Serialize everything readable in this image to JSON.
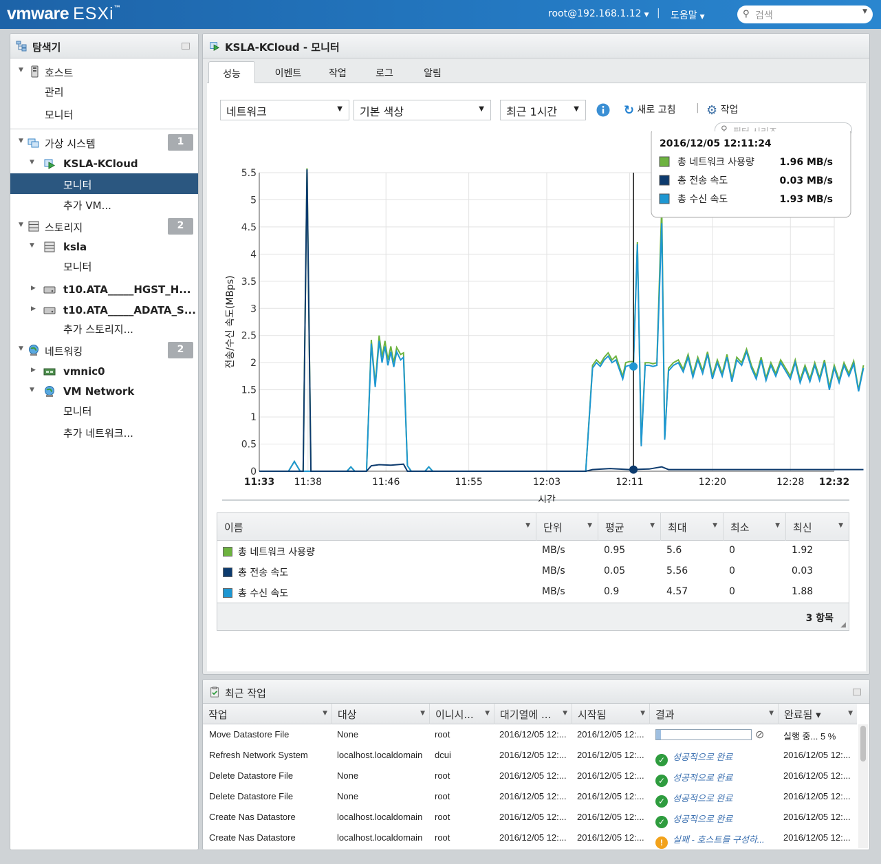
{
  "topbar": {
    "brand": "vmware",
    "product": "ESXi",
    "tm": "™",
    "user": "root@192.168.1.12",
    "separator": "|",
    "help": "도움말",
    "search_placeholder": "검색"
  },
  "navigator": {
    "title": "탐색기",
    "host": "호스트",
    "host_manage": "관리",
    "host_monitor": "모니터",
    "vms": "가상 시스템",
    "vms_count": "1",
    "vm_name": "KSLA-KCloud",
    "vm_monitor": "모니터",
    "vm_more": "추가 VM...",
    "storage": "스토리지",
    "storage_count": "2",
    "ds_name": "ksla",
    "ds_monitor": "모니터",
    "disk1": "t10.ATA_____HGST_H...",
    "disk2": "t10.ATA_____ADATA_S...",
    "storage_more": "추가 스토리지...",
    "networking": "네트워킹",
    "networking_count": "2",
    "nic": "vmnic0",
    "vmnet": "VM Network",
    "vmnet_monitor": "모니터",
    "net_more": "추가 네트워크..."
  },
  "main": {
    "title": "KSLA-KCloud - 모니터",
    "tabs": [
      "성능",
      "이벤트",
      "작업",
      "로그",
      "알림"
    ],
    "metric_select": "네트워크",
    "color_select": "기본 색상",
    "range_select": "최근 1시간",
    "refresh": "새로 고침",
    "actions": "작업",
    "filter_placeholder": "필터 시리즈"
  },
  "colors": {
    "usage": "#6db33f",
    "tx": "#0d3b6e",
    "rx": "#1e97d2"
  },
  "chart_data": {
    "type": "line",
    "ylabel": "전송/수신 속도(MBps)",
    "xlabel": "시간",
    "ylim": [
      0,
      5.5
    ],
    "yticks": [
      "0",
      "0.5",
      "1",
      "1.5",
      "2",
      "2.5",
      "3",
      "3.5",
      "4",
      "4.5",
      "5",
      "5.5"
    ],
    "xticks": [
      "11:33",
      "11:38",
      "11:46",
      "11:55",
      "12:03",
      "12:11",
      "12:20",
      "12:28",
      "12:32"
    ],
    "x_unit": "minutes after 11:33",
    "series": [
      {
        "name": "총 네트워크 사용량",
        "color": "#6db33f",
        "points": [
          [
            0,
            0
          ],
          [
            3,
            0
          ],
          [
            3.6,
            0.18
          ],
          [
            4.2,
            0
          ],
          [
            4.5,
            0
          ],
          [
            4.9,
            5.58
          ],
          [
            5.3,
            0
          ],
          [
            9,
            0
          ],
          [
            9.4,
            0.08
          ],
          [
            9.8,
            0
          ],
          [
            11,
            0
          ],
          [
            11.5,
            2.42
          ],
          [
            11.9,
            1.6
          ],
          [
            12.3,
            2.5
          ],
          [
            12.6,
            2.1
          ],
          [
            12.9,
            2.4
          ],
          [
            13.2,
            2.05
          ],
          [
            13.5,
            2.3
          ],
          [
            13.8,
            2.0
          ],
          [
            14.1,
            2.28
          ],
          [
            14.5,
            2.15
          ],
          [
            14.8,
            2.18
          ],
          [
            15.2,
            0.1
          ],
          [
            15.6,
            0
          ],
          [
            17,
            0
          ],
          [
            17.4,
            0.08
          ],
          [
            17.8,
            0
          ],
          [
            33.5,
            0
          ],
          [
            34.2,
            1.95
          ],
          [
            34.6,
            2.05
          ],
          [
            35,
            1.98
          ],
          [
            35.4,
            2.1
          ],
          [
            35.8,
            2.18
          ],
          [
            36.2,
            2.05
          ],
          [
            36.6,
            2.12
          ],
          [
            37,
            1.9
          ],
          [
            37.3,
            1.75
          ],
          [
            37.6,
            2.0
          ],
          [
            38,
            2.02
          ],
          [
            38.4,
            2.02
          ],
          [
            38.8,
            4.22
          ],
          [
            39.2,
            0.5
          ],
          [
            39.6,
            2.0
          ],
          [
            40,
            2.0
          ],
          [
            40.4,
            1.98
          ],
          [
            40.8,
            2.0
          ],
          [
            41.3,
            4.9
          ],
          [
            41.6,
            0.6
          ],
          [
            42,
            1.9
          ],
          [
            42.5,
            2.0
          ],
          [
            43,
            2.05
          ],
          [
            43.5,
            1.88
          ],
          [
            44,
            2.15
          ],
          [
            44.5,
            1.78
          ],
          [
            45,
            2.1
          ],
          [
            45.5,
            1.85
          ],
          [
            46,
            2.2
          ],
          [
            46.5,
            1.75
          ],
          [
            47,
            2.05
          ],
          [
            47.5,
            1.8
          ],
          [
            48,
            2.15
          ],
          [
            48.5,
            1.7
          ],
          [
            49,
            2.1
          ],
          [
            49.5,
            2.0
          ],
          [
            50,
            2.25
          ],
          [
            50.5,
            1.95
          ],
          [
            51,
            1.75
          ],
          [
            51.5,
            2.1
          ],
          [
            52,
            1.72
          ],
          [
            52.5,
            2.0
          ],
          [
            53,
            1.8
          ],
          [
            53.5,
            2.05
          ],
          [
            54,
            1.9
          ],
          [
            54.5,
            1.75
          ],
          [
            55,
            2.05
          ],
          [
            55.5,
            1.68
          ],
          [
            56,
            1.95
          ],
          [
            56.5,
            1.7
          ],
          [
            57,
            2.0
          ],
          [
            57.5,
            1.72
          ],
          [
            58,
            2.05
          ],
          [
            58.5,
            1.55
          ],
          [
            59,
            1.95
          ],
          [
            59.5,
            1.68
          ],
          [
            60,
            2.0
          ],
          [
            60.5,
            1.8
          ],
          [
            61,
            2.03
          ],
          [
            61.5,
            1.5
          ],
          [
            62,
            1.95
          ]
        ]
      },
      {
        "name": "총 전송 속도",
        "color": "#0d3b6e",
        "points": [
          [
            0,
            0
          ],
          [
            4.5,
            0
          ],
          [
            4.9,
            5.56
          ],
          [
            5.3,
            0
          ],
          [
            11,
            0
          ],
          [
            11.5,
            0.1
          ],
          [
            12.3,
            0.12
          ],
          [
            13.5,
            0.11
          ],
          [
            14.8,
            0.13
          ],
          [
            15.2,
            0
          ],
          [
            33.5,
            0
          ],
          [
            34.2,
            0.03
          ],
          [
            36,
            0.05
          ],
          [
            38,
            0.03
          ],
          [
            40,
            0.04
          ],
          [
            41.3,
            0.08
          ],
          [
            42,
            0.03
          ],
          [
            50,
            0.03
          ],
          [
            62,
            0.03
          ]
        ]
      },
      {
        "name": "총 수신 속도",
        "color": "#1e97d2",
        "points": [
          [
            0,
            0
          ],
          [
            3,
            0
          ],
          [
            3.6,
            0.18
          ],
          [
            4.2,
            0
          ],
          [
            9,
            0
          ],
          [
            9.4,
            0.08
          ],
          [
            9.8,
            0
          ],
          [
            11,
            0
          ],
          [
            11.5,
            2.35
          ],
          [
            11.9,
            1.55
          ],
          [
            12.3,
            2.4
          ],
          [
            12.6,
            2.0
          ],
          [
            12.9,
            2.3
          ],
          [
            13.2,
            1.95
          ],
          [
            13.5,
            2.2
          ],
          [
            13.8,
            1.92
          ],
          [
            14.1,
            2.2
          ],
          [
            14.5,
            2.05
          ],
          [
            14.8,
            2.1
          ],
          [
            15.2,
            0.1
          ],
          [
            15.6,
            0
          ],
          [
            17,
            0
          ],
          [
            17.4,
            0.08
          ],
          [
            17.8,
            0
          ],
          [
            33.5,
            0
          ],
          [
            34.2,
            1.9
          ],
          [
            34.6,
            2.0
          ],
          [
            35,
            1.93
          ],
          [
            35.4,
            2.05
          ],
          [
            35.8,
            2.12
          ],
          [
            36.2,
            2.0
          ],
          [
            36.6,
            2.05
          ],
          [
            37,
            1.85
          ],
          [
            37.3,
            1.7
          ],
          [
            37.6,
            1.93
          ],
          [
            38,
            1.95
          ],
          [
            38.4,
            1.98
          ],
          [
            38.8,
            4.18
          ],
          [
            39.2,
            0.46
          ],
          [
            39.6,
            1.95
          ],
          [
            40,
            1.95
          ],
          [
            40.4,
            1.93
          ],
          [
            40.8,
            1.95
          ],
          [
            41.3,
            4.57
          ],
          [
            41.6,
            0.58
          ],
          [
            42,
            1.85
          ],
          [
            42.5,
            1.95
          ],
          [
            43,
            2.0
          ],
          [
            43.5,
            1.83
          ],
          [
            44,
            2.1
          ],
          [
            44.5,
            1.73
          ],
          [
            45,
            2.05
          ],
          [
            45.5,
            1.8
          ],
          [
            46,
            2.15
          ],
          [
            46.5,
            1.7
          ],
          [
            47,
            2.0
          ],
          [
            47.5,
            1.75
          ],
          [
            48,
            2.1
          ],
          [
            48.5,
            1.65
          ],
          [
            49,
            2.05
          ],
          [
            49.5,
            1.95
          ],
          [
            50,
            2.2
          ],
          [
            50.5,
            1.9
          ],
          [
            51,
            1.7
          ],
          [
            51.5,
            2.05
          ],
          [
            52,
            1.67
          ],
          [
            52.5,
            1.95
          ],
          [
            53,
            1.75
          ],
          [
            53.5,
            2.0
          ],
          [
            54,
            1.85
          ],
          [
            54.5,
            1.7
          ],
          [
            55,
            2.0
          ],
          [
            55.5,
            1.63
          ],
          [
            56,
            1.9
          ],
          [
            56.5,
            1.65
          ],
          [
            57,
            1.95
          ],
          [
            57.5,
            1.67
          ],
          [
            58,
            2.0
          ],
          [
            58.5,
            1.5
          ],
          [
            59,
            1.9
          ],
          [
            59.5,
            1.63
          ],
          [
            60,
            1.95
          ],
          [
            60.5,
            1.75
          ],
          [
            61,
            1.98
          ],
          [
            61.5,
            1.47
          ],
          [
            62,
            1.9
          ]
        ]
      }
    ],
    "cursor_x": 38.4,
    "tooltip": {
      "time": "2016/12/05 12:11:24",
      "rows": [
        {
          "name": "총 네트워크 사용량",
          "value": "1.96 MB/s"
        },
        {
          "name": "총 전송 속도",
          "value": "0.03 MB/s"
        },
        {
          "name": "총 수신 속도",
          "value": "1.93 MB/s"
        }
      ]
    }
  },
  "legend_table": {
    "headers": [
      "이름",
      "단위",
      "평균",
      "최대",
      "최소",
      "최신"
    ],
    "rows": [
      [
        "총 네트워크 사용량",
        "MB/s",
        "0.95",
        "5.6",
        "0",
        "1.92"
      ],
      [
        "총 전송 속도",
        "MB/s",
        "0.05",
        "5.56",
        "0",
        "0.03"
      ],
      [
        "총 수신 속도",
        "MB/s",
        "0.9",
        "4.57",
        "0",
        "1.88"
      ]
    ],
    "footer": "3 항목"
  },
  "recent_tasks": {
    "title": "최근 작업",
    "headers": [
      "작업",
      "대상",
      "이니시...",
      "대기열에 ...",
      "시작됨",
      "결과",
      "완료됨 ▾"
    ],
    "rows": [
      {
        "task": "Move Datastore File",
        "target": "None",
        "initiator": "root",
        "queued": "2016/12/05 12:...",
        "started": "2016/12/05 12:...",
        "result": "",
        "done": "실행 중... 5 %",
        "status": "running",
        "progress": 0.05
      },
      {
        "task": "Refresh Network System",
        "target": "localhost.localdomain",
        "initiator": "dcui",
        "queued": "2016/12/05 12:...",
        "started": "2016/12/05 12:...",
        "result": "성공적으로 완료",
        "done": "2016/12/05 12:...",
        "status": "ok"
      },
      {
        "task": "Delete Datastore File",
        "target": "None",
        "initiator": "root",
        "queued": "2016/12/05 12:...",
        "started": "2016/12/05 12:...",
        "result": "성공적으로 완료",
        "done": "2016/12/05 12:...",
        "status": "ok"
      },
      {
        "task": "Delete Datastore File",
        "target": "None",
        "initiator": "root",
        "queued": "2016/12/05 12:...",
        "started": "2016/12/05 12:...",
        "result": "성공적으로 완료",
        "done": "2016/12/05 12:...",
        "status": "ok"
      },
      {
        "task": "Create Nas Datastore",
        "target": "localhost.localdomain",
        "initiator": "root",
        "queued": "2016/12/05 12:...",
        "started": "2016/12/05 12:...",
        "result": "성공적으로 완료",
        "done": "2016/12/05 12:...",
        "status": "ok"
      },
      {
        "task": "Create Nas Datastore",
        "target": "localhost.localdomain",
        "initiator": "root",
        "queued": "2016/12/05 12:...",
        "started": "2016/12/05 12:...",
        "result": "실패 - 호스트를 구성하...",
        "done": "2016/12/05 12:...",
        "status": "fail"
      }
    ]
  }
}
